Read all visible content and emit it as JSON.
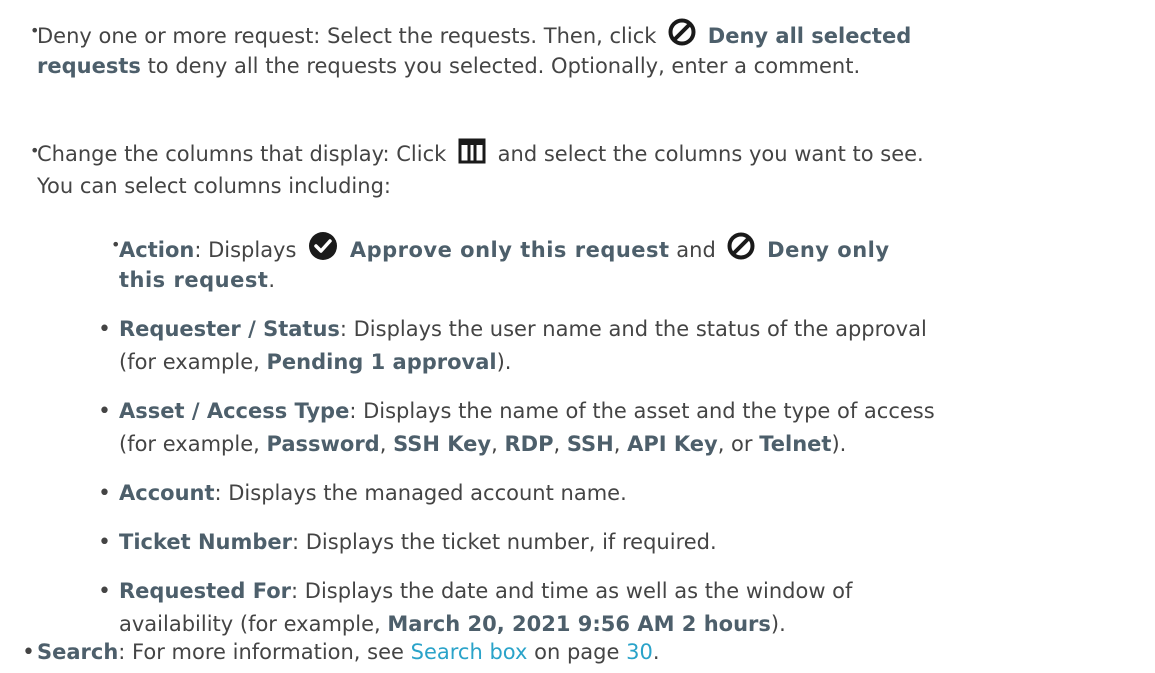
{
  "bullets": {
    "deny": {
      "prefix": "Deny one or more request: Select the requests. Then, click",
      "bold": "Deny all selected",
      "bold2": "requests",
      "rest": "to deny all the requests you selected. Optionally, enter a comment.",
      "icon": "deny-icon"
    },
    "columns": {
      "prefix": "Change the columns that display: Click",
      "rest": "and select the columns you want to see.",
      "line2": "You can select columns including:",
      "icon": "columns-icon"
    },
    "search": {
      "bold": "Search",
      "text": ": For more information, see",
      "link": "Search box",
      "mid": "on page",
      "page": "30",
      "end": "."
    }
  },
  "columns": {
    "action": {
      "bold": "Action",
      "text": ": Displays",
      "approve": "Approve only this request",
      "and": "and",
      "deny": "Deny only",
      "deny2": "this request",
      "end": "."
    },
    "requester": {
      "bold": "Requester / Status",
      "text": ": Displays the user name and the status of the approval",
      "line2a": "(for example,",
      "line2b": "Pending 1 approval",
      "line2c": ")."
    },
    "asset": {
      "bold": "Asset / Access Type",
      "text": ": Displays the name of the asset and the type of access",
      "line2a": "(for example,",
      "v1": "Password",
      "v2": "SSH Key",
      "v3": "RDP",
      "v4": "SSH",
      "v5": "API Key",
      "or": ", or",
      "v6": "Telnet",
      "end": ")."
    },
    "account": {
      "bold": "Account",
      "text": ": Displays the managed account name."
    },
    "ticket": {
      "bold": "Ticket Number",
      "text": ": Displays the ticket number, if required."
    },
    "requested": {
      "bold": "Requested For",
      "text": ": Displays the date and time as well as the window of",
      "line2a": "availability (for example,",
      "line2b": "March 20, 2021 9:56 AM 2 hours",
      "line2c": ")."
    }
  }
}
